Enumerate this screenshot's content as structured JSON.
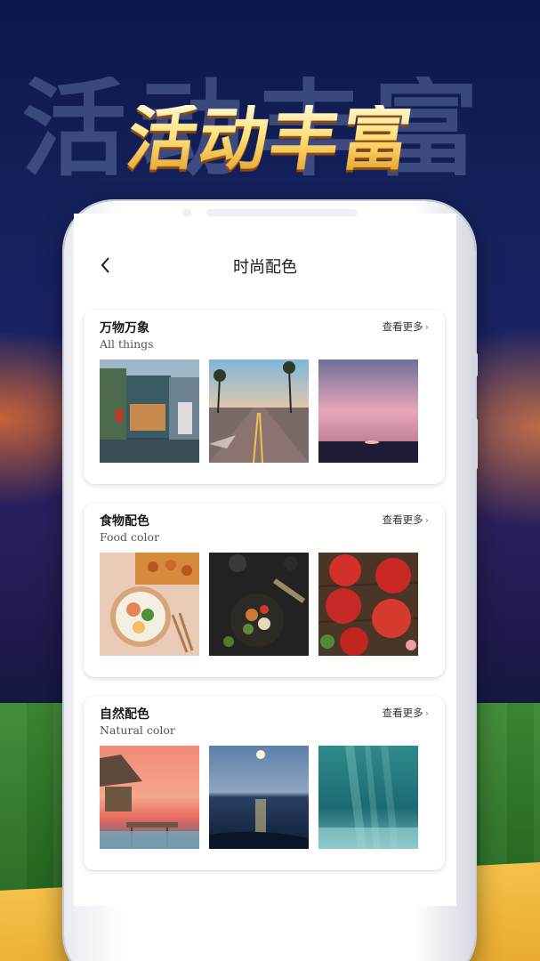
{
  "promo": {
    "title": "活动丰富",
    "ghost_title": "活动丰富"
  },
  "nav": {
    "back_icon": "chevron-left-icon",
    "title": "时尚配色"
  },
  "sections": [
    {
      "title": "万物万象",
      "subtitle": "All things",
      "more_label": "查看更多",
      "images": [
        "street-storefront-photo",
        "palm-road-photo",
        "pink-sunset-sea-photo"
      ]
    },
    {
      "title": "食物配色",
      "subtitle": "Food color",
      "more_label": "查看更多",
      "images": [
        "noodle-bowl-photo",
        "dark-dish-photo",
        "strawberry-tart-photo"
      ]
    },
    {
      "title": "自然配色",
      "subtitle": "Natural color",
      "more_label": "查看更多",
      "images": [
        "stilt-hut-sunset-photo",
        "moonlit-ocean-photo",
        "underwater-light-photo"
      ]
    }
  ],
  "colors": {
    "title_gold": "#ffd76a",
    "ribbon_gold": "#f4c24a",
    "field_green": "#2c7326",
    "stage_navy": "#0b1849"
  }
}
